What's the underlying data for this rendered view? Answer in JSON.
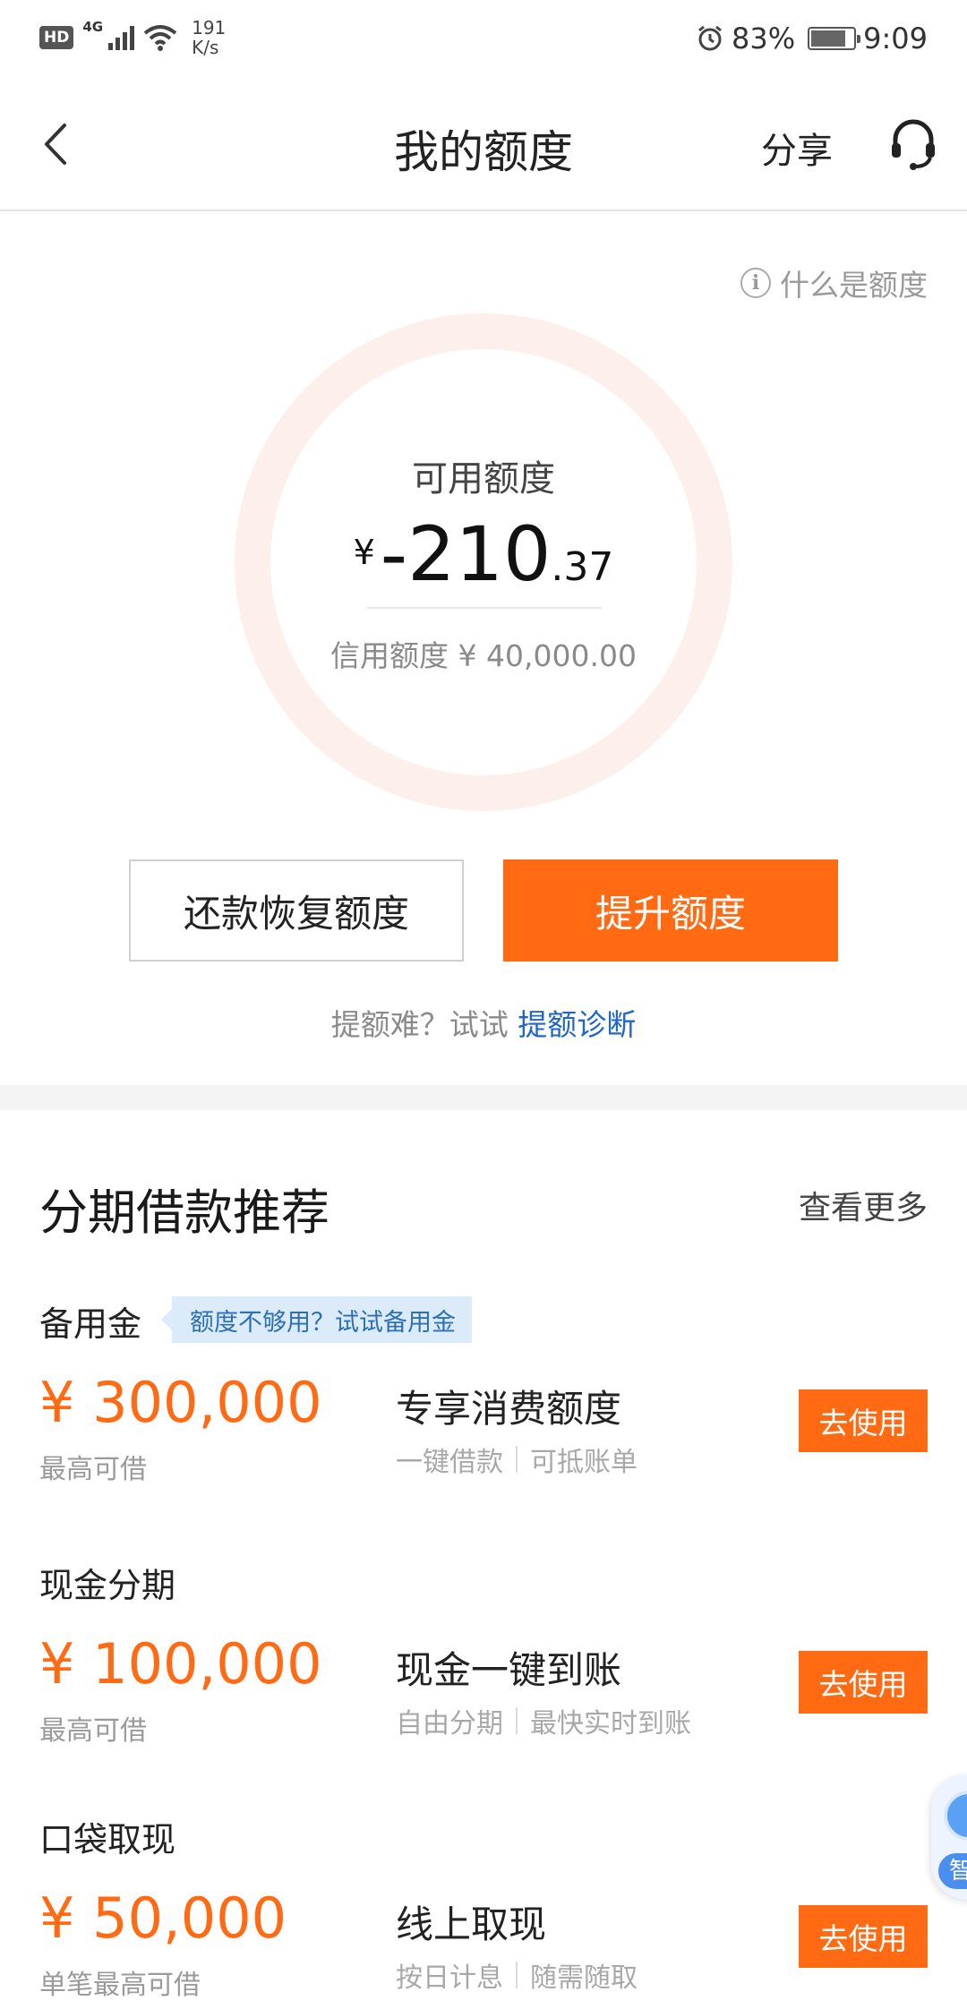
{
  "status_bar": {
    "hd": "HD",
    "network": "4G",
    "net_speed_value": "191",
    "net_speed_unit": "K/s",
    "battery": "83%",
    "time": "9:09"
  },
  "nav": {
    "title": "我的额度",
    "share": "分享"
  },
  "quota": {
    "help_link": "什么是额度",
    "available_label": "可用额度",
    "currency": "¥",
    "available_int": "-210",
    "available_dec": ".37",
    "credit_limit": "信用额度 ¥ 40,000.00",
    "repay_button": "还款恢复额度",
    "raise_button": "提升额度",
    "diag_prefix": "提额难？试试 ",
    "diag_link": "提额诊断"
  },
  "recommend": {
    "title": "分期借款推荐",
    "more": "查看更多",
    "products": [
      {
        "name": "备用金",
        "tag": "额度不够用？试试备用金",
        "amount": "¥ 300,000",
        "sub": "最高可借",
        "feature": "专享消费额度",
        "desc1": "一键借款",
        "desc2": "可抵账单",
        "button": "去使用"
      },
      {
        "name": "现金分期",
        "amount": "¥ 100,000",
        "sub": "最高可借",
        "feature": "现金一键到账",
        "desc1": "自由分期",
        "desc2": "最快实时到账",
        "button": "去使用"
      },
      {
        "name": "口袋取现",
        "amount": "¥ 50,000",
        "sub": "单笔最高可借",
        "feature": "线上取现",
        "desc1": "按日计息",
        "desc2": "随需随取",
        "button": "去使用"
      }
    ]
  },
  "assistant": {
    "label": "智"
  },
  "colors": {
    "accent": "#ff6a13",
    "link": "#1f66c7",
    "ring": "#fdf0ec"
  }
}
